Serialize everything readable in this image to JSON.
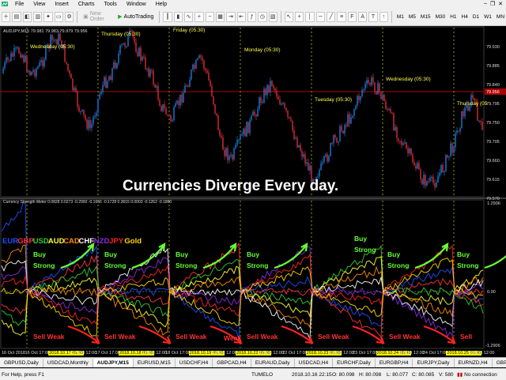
{
  "menu": [
    "File",
    "View",
    "Insert",
    "Charts",
    "Tools",
    "Window",
    "Help"
  ],
  "toolbar": {
    "new_order": "New Order",
    "autotrading": "AutoTrading",
    "timeframes": [
      "M1",
      "M5",
      "M15",
      "M30",
      "H1",
      "H4",
      "D1",
      "W1",
      "MN"
    ]
  },
  "chart": {
    "main_title": "AUDJPY,M15  79.981 79.983 79.979 79.956",
    "indicator_title": "Currency Strength Meter  0.0828 0.0273 -0.2992 -0.1666 -0.1728 0.3615 0.0003 -0.1262 -0.1860",
    "day_labels": [
      "Wednesday (05:30)",
      "Thursday (05:30)",
      "Friday (05:30)",
      "Monday (05:30)",
      "Tuesday (05:30)",
      "Wednesday (05:30)",
      "Thursday (05"
    ],
    "headline": "Currencies Diverge Every day.",
    "legend": [
      {
        "name": "EUR",
        "color": "#1f4fff"
      },
      {
        "name": "GBP",
        "color": "#ff3333"
      },
      {
        "name": "USD",
        "color": "#33cc33"
      },
      {
        "name": "AUD",
        "color": "#ffff33"
      },
      {
        "name": "CAD",
        "color": "#ff8c00"
      },
      {
        "name": "CHF",
        "color": "#ffffff"
      },
      {
        "name": "NZD",
        "color": "#8a2be2"
      },
      {
        "name": "JPY",
        "color": "#ff2222"
      },
      {
        "name": "Gold",
        "color": "#ffd700"
      }
    ],
    "buy_label": "Buy Strong",
    "sell_label": "Sell Weak",
    "weak_label": "Weak",
    "price_scale": [
      "79.930",
      "79.885",
      "79.840",
      "79.795",
      "79.750",
      "79.705",
      "79.660",
      "79.615",
      "79.570"
    ],
    "current_price": "79.956",
    "ind_scale": [
      "1.2906",
      "0.00",
      "-1.2906"
    ],
    "date_labels": [
      {
        "t": "16 Oct 2018",
        "hl": false
      },
      {
        "t": "16 Oct 17:00",
        "hl": false
      },
      {
        "t": "2018.10.17 05:30",
        "hl": true
      },
      {
        "t": "17 Oct 12:00",
        "hl": false
      },
      {
        "t": "17 Oct 17:00",
        "hl": false
      },
      {
        "t": "2018.10.18 05:30",
        "hl": true
      },
      {
        "t": "18 Oct 12:00",
        "hl": false
      },
      {
        "t": "18 Oct 17:00",
        "hl": false
      },
      {
        "t": "2018.10.19 05:30",
        "hl": true
      },
      {
        "t": "19 Oct 12:00",
        "hl": false
      },
      {
        "t": "2018.10.22 05:30",
        "hl": true
      },
      {
        "t": "22 Oct 12:00",
        "hl": false
      },
      {
        "t": "22 Oct 17:00",
        "hl": false
      },
      {
        "t": "2018.10.23 05:30",
        "hl": true
      },
      {
        "t": "23 Oct 12:00",
        "hl": false
      },
      {
        "t": "23 Oct 17:00",
        "hl": false
      },
      {
        "t": "2018.10.24 05:30",
        "hl": true
      },
      {
        "t": "24 Oct 12:00",
        "hl": false
      },
      {
        "t": "24 Oct 17:00",
        "hl": false
      },
      {
        "t": "2018.10.25 05:30",
        "hl": true
      },
      {
        "t": "25 Oct 12:00",
        "hl": false
      }
    ]
  },
  "tabs": [
    "GBPUSD,Daily",
    "USDCAD,Monthly",
    "AUDJPY,M15",
    "EURUSD,M15",
    "USDCHF,H4",
    "GBPCAD,H4",
    "EURAUD,Daily",
    "USDCAD,H4",
    "EURCHF,Daily",
    "EURGBP,H4",
    "EURJPY,Daily",
    "EURNZD,H4",
    "GBPCAD,H4",
    "GB"
  ],
  "active_tab": 2,
  "status": {
    "help": "For Help, press F1",
    "profile": "TUMELO",
    "time": "2018.10.16 22:15",
    "open": "O: 80.098",
    "high": "H: 80.098",
    "low": "L: 80.077",
    "close": "C: 80.085",
    "volume": "V: 580",
    "connection": "No connection"
  }
}
